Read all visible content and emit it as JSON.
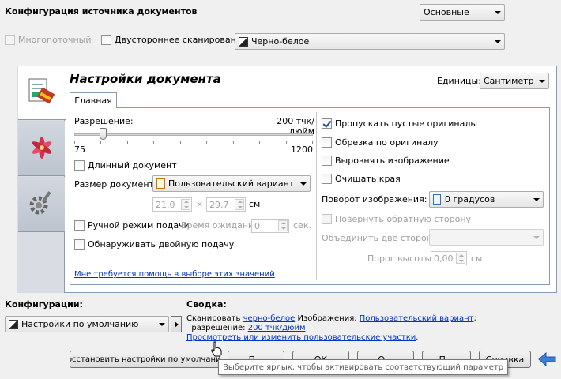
{
  "header": {
    "title": "Конфигурация источника документов",
    "mode_select": "Основные",
    "multistream_label": "Многопоточный",
    "duplex_label": "Двустороннее сканирование",
    "color_select": "Черно-белое"
  },
  "tabs": {
    "icon_document": "document-settings-icon",
    "icon_image": "image-lily-icon",
    "icon_device": "device-gear-icon"
  },
  "panel": {
    "title": "Настройки документа",
    "units_label": "Единицы:",
    "units_value": "Сантиметры",
    "subtab_main": "Главная"
  },
  "left": {
    "resolution_label": "Разрешение:",
    "resolution_value": "200 тчк/дюйм",
    "slider_min": "75",
    "slider_max": "1200",
    "slider_fraction": 0.11,
    "long_doc_label": "Длинный документ",
    "doc_size_label": "Размер документа:",
    "doc_size_value": "Пользовательский вариант",
    "width_value": "21,0",
    "times": "×",
    "height_value": "29,7",
    "unit": "см",
    "manual_feed_label": "Ручной режим подачи",
    "wait_label": "Время ожидания:",
    "wait_value": "0",
    "sec_label": "сек.",
    "double_feed_label": "Обнаруживать двойную подачу",
    "help_link": "Мне требуется помощь в выборе этих значений"
  },
  "right": {
    "skip_blank_label": "Пропускать пустые оригиналы",
    "skip_blank_checked": true,
    "crop_label": "Обрезка по оригиналу",
    "straighten_label": "Выровнять изображение",
    "clean_edges_label": "Очищать края",
    "rotation_label": "Поворот изображения:",
    "rotation_value": "0 градусов",
    "flip_label": "Повернуть обратную сторону",
    "merge_label": "Объединить две стороны:",
    "merge_value": "",
    "height_threshold_label": "Порог высоты:",
    "height_threshold_value": "0,00",
    "height_threshold_unit": "см"
  },
  "bottom": {
    "configs_label": "Конфигурации:",
    "config_value": "Настройки по умолчанию",
    "summary_label": "Сводка:",
    "summary_scan_prefix": "Сканировать",
    "summary_scan_link": "черно-белое",
    "summary_images_prefix": "Изображения:",
    "summary_images_link": "Пользовательский вариант",
    "summary_semicolon": ";",
    "summary_res_prefix": "разрешение:",
    "summary_res_link": "200 тчк/дюйм",
    "summary_regions_link": "Просмотреть или изменить пользовательские участки",
    "summary_period": ".",
    "restore_button": "Восстановить настройки по умолчанию",
    "btn2": "П...",
    "btn_ok": "ОК",
    "btn4": "О...",
    "btn5": "П...",
    "btn_help": "Справка",
    "tooltip": "Выберите ярлык, чтобы активировать соответствующий параметр"
  },
  "colors": {
    "link": "#0033cc",
    "panel_border": "#8a9bb0",
    "back_arrow": "#3b7dd8"
  }
}
